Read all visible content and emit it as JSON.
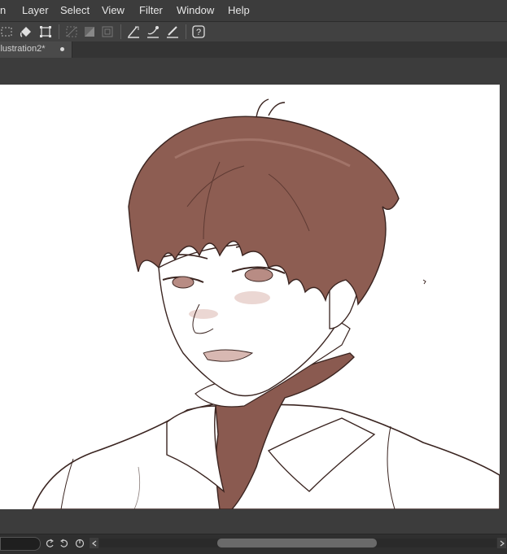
{
  "menu": {
    "items": [
      {
        "key": "animation",
        "label": "n"
      },
      {
        "key": "layer",
        "label": "Layer"
      },
      {
        "key": "select",
        "label": "Select"
      },
      {
        "key": "view",
        "label": "View"
      },
      {
        "key": "filter",
        "label": "Filter"
      },
      {
        "key": "window",
        "label": "Window"
      },
      {
        "key": "help",
        "label": "Help"
      }
    ]
  },
  "toolbar": {
    "icons": [
      "select-all-icon",
      "fill-icon",
      "transform-icon",
      "clear-selection-icon",
      "invert-selection-icon",
      "selection-border-icon",
      "ruler-icon",
      "bucket-ruler-icon",
      "pen-ruler-icon",
      "help-icon"
    ]
  },
  "tab": {
    "title": "llustration2*",
    "modified_dot": "●"
  },
  "colors": {
    "hair": "#8d5d52",
    "line": "#3a2420",
    "skin_shadow": "#d8b8b2",
    "shirt_inner": "#8a5a50",
    "ui_bg": "#3c3c3c"
  },
  "statusbar": {
    "icons": [
      "rotate-left-icon",
      "rotate-right-icon",
      "reset-rotation-icon",
      "scroll-left-icon",
      "scroll-right-icon"
    ]
  }
}
